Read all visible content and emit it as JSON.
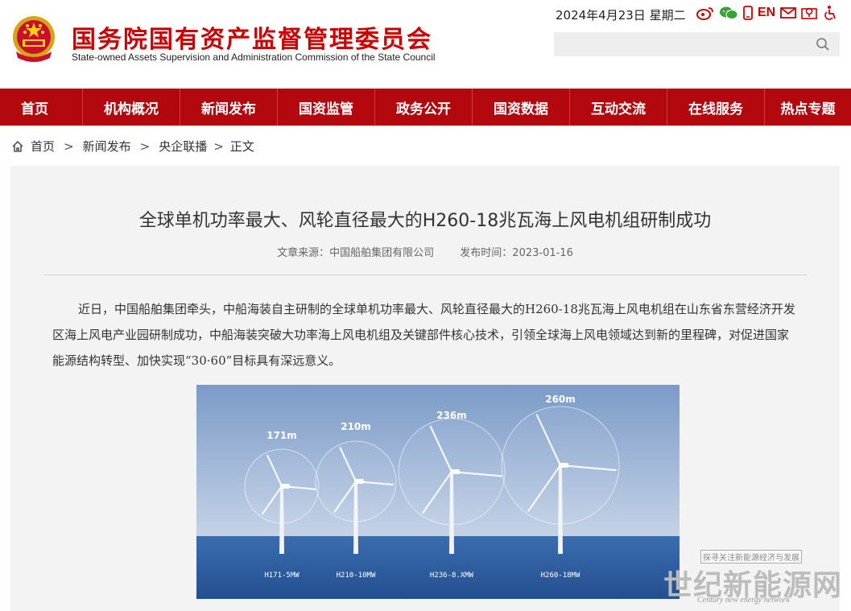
{
  "header": {
    "site_name_cn": "国务院国有资产监督管理委员会",
    "site_name_en": "State-owned Assets Supervision and Administration Commission of the State Council",
    "date_text": "2024年4月23日 星期二",
    "lang_link": "EN",
    "search_placeholder": ""
  },
  "nav": [
    "首页",
    "机构概况",
    "新闻发布",
    "国资监管",
    "政务公开",
    "国资数据",
    "互动交流",
    "在线服务",
    "热点专题"
  ],
  "breadcrumb": {
    "home": "首页",
    "level1": "新闻发布",
    "level2": "央企联播",
    "current": "正文",
    "sep": ">"
  },
  "article": {
    "title": "全球单机功率最大、风轮直径最大的H260-18兆瓦海上风电机组研制成功",
    "source": "文章来源：中国船舶集团有限公司",
    "date": "发布时间：2023-01-16",
    "paragraph": "近日，中国船舶集团牵头，中船海装自主研制的全球单机功率最大、风轮直径最大的H260-18兆瓦海上风电机组在山东省东营经济开发区海上风电产业园研制成功，中船海装突破大功率海上风电机组及关键部件核心技术，引领全球海上风电领域达到新的里程碑，对促进国家能源结构转型、加快实现“30·60”目标具有深远意义。"
  },
  "figure": {
    "turbines": [
      {
        "diameter": "171m",
        "model": "H171-5MW"
      },
      {
        "diameter": "210m",
        "model": "H210-10MW"
      },
      {
        "diameter": "236m",
        "model": "H236-8.XMW"
      },
      {
        "diameter": "260m",
        "model": "H260-18MW"
      }
    ]
  },
  "watermark": {
    "small": "探寻关注新能源经济与发展",
    "big": "世纪新能源网",
    "en": "Century new energy network"
  },
  "colors": {
    "brand_red": "#b3090e",
    "title_red": "#cc0000",
    "sky": "#8fa8cf",
    "sea": "#2f5f9e"
  }
}
